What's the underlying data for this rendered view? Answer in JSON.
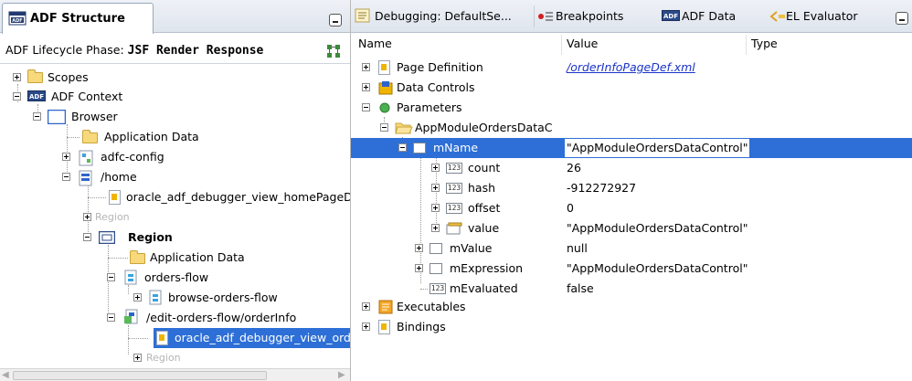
{
  "left_panel": {
    "tab_title": "ADF Structure",
    "phase_label": "ADF Lifecycle Phase:",
    "phase_value": "JSF Render Response",
    "tree": [
      {
        "label": "Scopes"
      },
      {
        "label": "ADF Context"
      },
      {
        "label": "Browser"
      },
      {
        "label": "Application Data"
      },
      {
        "label": "adfc-config"
      },
      {
        "label": "/home"
      },
      {
        "label": "oracle_adf_debugger_view_homePageD"
      },
      {
        "label": "Region"
      },
      {
        "label": "Region"
      },
      {
        "label": "Application Data"
      },
      {
        "label": "orders-flow"
      },
      {
        "label": "browse-orders-flow"
      },
      {
        "label": "/edit-orders-flow/orderInfo"
      },
      {
        "label": "oracle_adf_debugger_view_ord"
      },
      {
        "label": "Region"
      }
    ]
  },
  "right_panel": {
    "tabs": [
      {
        "label": "Debugging: DefaultSe..."
      },
      {
        "label": "Breakpoints"
      },
      {
        "label": "ADF Data"
      },
      {
        "label": "EL Evaluator"
      }
    ],
    "columns": [
      "Name",
      "Value",
      "Type"
    ],
    "rows": [
      {
        "name": "Page Definition",
        "value": "/orderInfoPageDef.xml"
      },
      {
        "name": "Data Controls",
        "value": ""
      },
      {
        "name": "Parameters",
        "value": ""
      },
      {
        "name": "AppModuleOrdersDataC",
        "value": ""
      },
      {
        "name": "mName",
        "value": "\"AppModuleOrdersDataControl\""
      },
      {
        "name": "count",
        "value": "26"
      },
      {
        "name": "hash",
        "value": "-912272927"
      },
      {
        "name": "offset",
        "value": "0"
      },
      {
        "name": "value",
        "value": "\"AppModuleOrdersDataControl\""
      },
      {
        "name": "mValue",
        "value": "null"
      },
      {
        "name": "mExpression",
        "value": "\"AppModuleOrdersDataControl\""
      },
      {
        "name": "mEvaluated",
        "value": "false"
      },
      {
        "name": "Executables",
        "value": ""
      },
      {
        "name": "Bindings",
        "value": ""
      }
    ]
  },
  "icons": {
    "adf_badge_text": "ADF",
    "int_badge_text": "123"
  },
  "colors": {
    "selection": "#2d6fd6",
    "link": "#1a33c8",
    "folder": "#f7d87a"
  }
}
